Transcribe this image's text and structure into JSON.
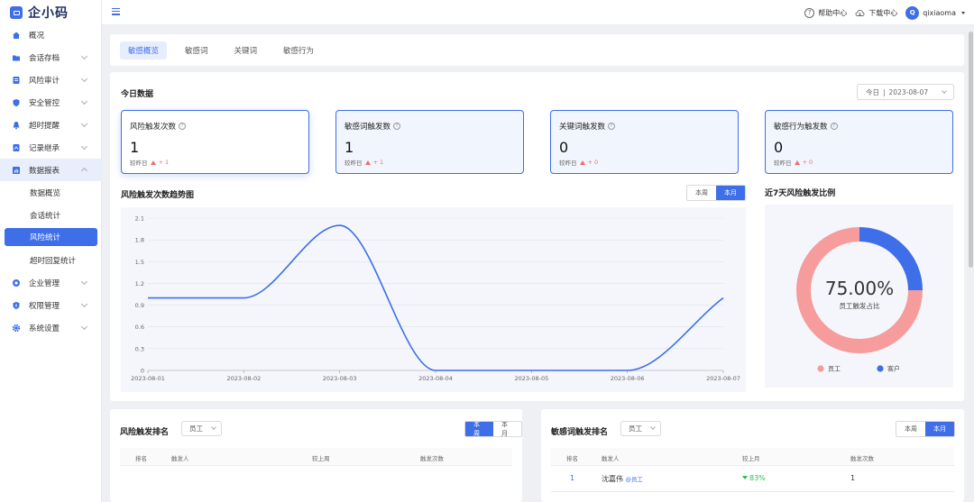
{
  "app": {
    "name": "企小码"
  },
  "sidebar": {
    "items": [
      {
        "label": "概况",
        "icon": "home-icon"
      },
      {
        "label": "会话存档",
        "icon": "folder-icon"
      },
      {
        "label": "风险审计",
        "icon": "audit-icon"
      },
      {
        "label": "安全管控",
        "icon": "shield-icon"
      },
      {
        "label": "超时提醒",
        "icon": "bell-icon"
      },
      {
        "label": "记录继承",
        "icon": "record-icon"
      },
      {
        "label": "数据报表",
        "icon": "report-icon"
      },
      {
        "label": "企业管理",
        "icon": "enterprise-icon"
      },
      {
        "label": "权限管理",
        "icon": "permission-icon"
      },
      {
        "label": "系统设置",
        "icon": "gear-icon"
      }
    ],
    "report_sub": [
      "数据概览",
      "会话统计",
      "风险统计",
      "超时回复统计"
    ]
  },
  "header": {
    "help": "帮助中心",
    "download": "下载中心",
    "avatar_letter": "Q",
    "user": "qixiaoma"
  },
  "tabs": [
    "敏感概览",
    "敏感词",
    "关键词",
    "敏感行为"
  ],
  "today": {
    "title": "今日数据",
    "date_label": "今日",
    "date_sep": "|",
    "date": "2023-08-07",
    "kpis": [
      {
        "label": "风险触发次数",
        "value": "1",
        "cmp": "较昨日",
        "delta": "+ 1"
      },
      {
        "label": "敏感词触发数",
        "value": "1",
        "cmp": "较昨日",
        "delta": "+ 1"
      },
      {
        "label": "关键词触发数",
        "value": "0",
        "cmp": "较昨日",
        "delta": "+ 0"
      },
      {
        "label": "敏感行为触发数",
        "value": "0",
        "cmp": "较昨日",
        "delta": "+ 0"
      }
    ]
  },
  "trend": {
    "title": "风险触发次数趋势图",
    "week": "本周",
    "month": "本月"
  },
  "ratio": {
    "title": "近7天风险触发比例",
    "percent": "75.00%",
    "subtitle": "员工触发占比",
    "legend_staff": "员工",
    "legend_customer": "客户"
  },
  "rank_left": {
    "title": "风险触发排名",
    "filter": "员工",
    "week": "本周",
    "month": "本月",
    "cols": [
      "排名",
      "触发人",
      "较上周",
      "触发次数"
    ]
  },
  "rank_right": {
    "title": "敏感词触发排名",
    "filter": "员工",
    "week": "本周",
    "month": "本月",
    "cols": [
      "排名",
      "触发人",
      "较上月",
      "触发次数"
    ],
    "rows": [
      {
        "rank": "1",
        "name": "沈嘉伟",
        "tag": "@员工",
        "change": "83%",
        "count": "1"
      }
    ]
  },
  "colors": {
    "primary": "#3e6ee8",
    "staff": "#f69c9c",
    "customer": "#3e6ee8",
    "up": "#f26b6b",
    "down": "#2dbb4e"
  },
  "chart_data": [
    {
      "type": "line",
      "x": [
        "2023-08-01",
        "2023-08-02",
        "2023-08-03",
        "2023-08-04",
        "2023-08-05",
        "2023-08-06",
        "2023-08-07"
      ],
      "series": [
        {
          "values": [
            1,
            1,
            2,
            0,
            0,
            0,
            1
          ]
        }
      ],
      "yticks": [
        "0",
        "0.3",
        "0.6",
        "0.9",
        "1.2",
        "1.5",
        "1.8",
        "2.1"
      ],
      "ylim": [
        0,
        2.1
      ],
      "smooth": true
    },
    {
      "type": "pie",
      "categories": [
        "员工",
        "客户"
      ],
      "values": [
        75,
        25
      ],
      "donut": true
    }
  ]
}
